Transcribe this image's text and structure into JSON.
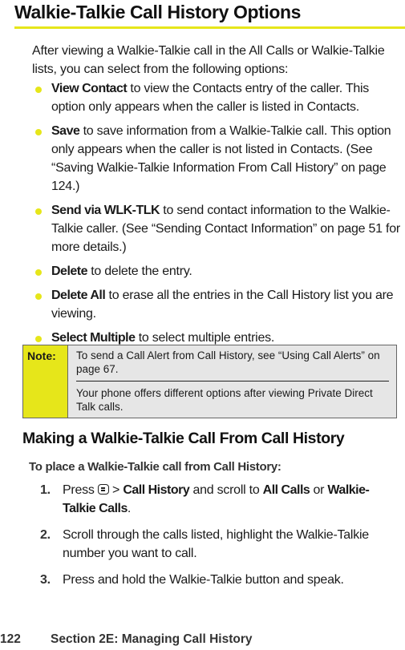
{
  "page": {
    "title": "Walkie-Talkie Call History Options",
    "intro": "After viewing a Walkie-Talkie call in the All Calls or Walkie-Talkie lists, you can select from the following options:",
    "bullets": [
      {
        "term": "View Contact",
        "text": " to view the Contacts entry of the caller. This option only appears when the caller is listed in Contacts."
      },
      {
        "term": "Save",
        "text": " to save information from a Walkie-Talkie call. This option only appears when the caller is not listed in Contacts. (See “Saving Walkie-Talkie Information From Call History” on page 124.)"
      },
      {
        "term": "Send via WLK-TLK",
        "text": " to send contact information to the Walkie-Talkie caller. (See “Sending Contact Information” on page 51 for more details.)"
      },
      {
        "term": "Delete",
        "text": " to delete the entry."
      },
      {
        "term": "Delete All",
        "text": " to erase all the entries in the Call History list you are viewing."
      },
      {
        "term": "Select Multiple",
        "text": " to select multiple entries."
      }
    ],
    "note": {
      "label": "Note:",
      "items": [
        "To send a Call Alert from Call History, see “Using Call Alerts” on page 67.",
        "Your phone offers different options after viewing Private Direct Talk calls."
      ]
    },
    "section_heading": "Making a Walkie-Talkie Call From Call History",
    "lead": "To place a Walkie-Talkie call from Call History:",
    "steps": [
      {
        "num": "1.",
        "parts": [
          "Press ",
          "menu-key-icon",
          " > ",
          "Call History",
          " and scroll to ",
          "All Calls",
          " or ",
          "Walkie-Talkie Calls",
          "."
        ]
      },
      {
        "num": "2.",
        "text": "Scroll through the calls listed, highlight the Walkie-Talkie number you want to call."
      },
      {
        "num": "3.",
        "text": "Press and hold the Walkie-Talkie button and speak."
      }
    ],
    "step1": {
      "press": "Press ",
      "sep": " > ",
      "call_history": "Call History",
      "scroll": " and scroll to ",
      "all_calls": "All Calls",
      "or": " or ",
      "wt_calls": "Walkie-Talkie Calls",
      "end": "."
    },
    "footer": {
      "page_number": "122",
      "section": "Section 2E: Managing Call History"
    },
    "colors": {
      "accent": "#e6e61a",
      "note_bg": "#e6e6e6"
    }
  }
}
